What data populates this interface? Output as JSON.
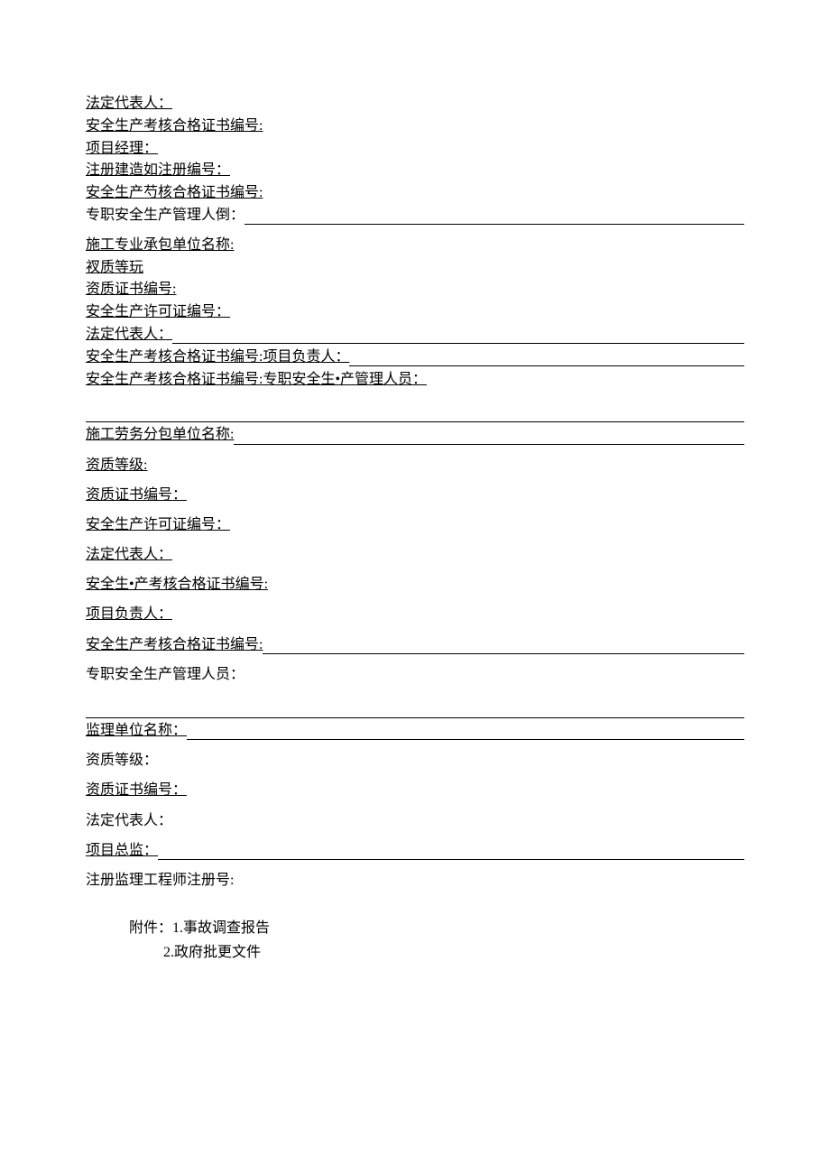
{
  "sec1": {
    "legal_rep": "法定代表人：",
    "safety_cert_no": "安全生产考核合格证书编号:",
    "project_manager": "项目经理：",
    "reg_constructor_no": "注册建造如注册编号：",
    "safety_assess_cert_no": "安全生产芍核合格证书编号:",
    "fulltime_safety_mgr": "专职安全生产管理人倒："
  },
  "sec2": {
    "contractor_name": "施工专业承包单位名称:",
    "qual_level": "衩质等玩",
    "qual_cert_no": "资质证书编号:",
    "safety_permit_no": "安全生产许可证编号：",
    "legal_rep": "法定代表人：",
    "safety_cert_no_pm": "安全生产考核合格证书编号:项目负责人：",
    "safety_cert_no_staff": "安全生产考核合格证书编号:专职安全生•产管理人员："
  },
  "sec3": {
    "labor_sub_name": "施工劳务分包单位名称:",
    "qual_level": "资质等级:",
    "qual_cert_no": "资质证书编号：",
    "safety_permit_no": "安全生产许可证编号：",
    "legal_rep": "法定代表人：",
    "safety_assess_cert_no": "安全生•产考核合格证书编号:",
    "proj_leader": "项目负责人：",
    "safety_cert_no2": "安全生产考核合格证书编号:",
    "fulltime_safety_mgr": "专职安全生产管理人员："
  },
  "sec4": {
    "supervision_name": "监理单位名称：",
    "qual_level": "资质等级：",
    "qual_cert_no": "资质证书编号：",
    "legal_rep": "法定代表人：",
    "proj_chief": "项目总监：",
    "reg_supervisor_no": "注册监理工程师注册号:"
  },
  "attachments": {
    "prefix": "附件：",
    "item1": "1.事故调查报告",
    "item2": "2.政府批更文件"
  }
}
